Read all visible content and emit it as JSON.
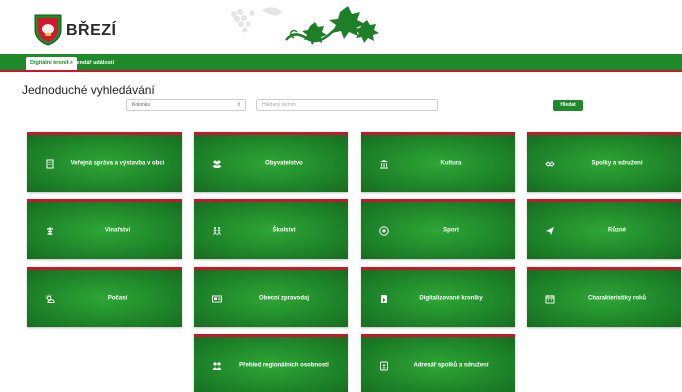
{
  "header": {
    "brand": "BŘEZÍ"
  },
  "nav": {
    "tabs": [
      "Digitální kronika",
      "Kalendář událostí"
    ]
  },
  "search": {
    "title": "Jednoduché vyhledávání",
    "select_value": "Kolonka",
    "input_placeholder": "Hledaný termín",
    "button_label": "Hledat"
  },
  "tiles": [
    {
      "label": "Veřejná správa a výstavba v obci",
      "icon": "building-icon"
    },
    {
      "label": "Obyvatelstvo",
      "icon": "people-icon"
    },
    {
      "label": "Kultura",
      "icon": "museum-icon"
    },
    {
      "label": "Spolky a sdružení",
      "icon": "handshake-icon"
    },
    {
      "label": "Vinařství",
      "icon": "grapevine-icon"
    },
    {
      "label": "Školství",
      "icon": "children-icon"
    },
    {
      "label": "Sport",
      "icon": "football-icon"
    },
    {
      "label": "Různé",
      "icon": "paper-plane-icon"
    },
    {
      "label": "Počasí",
      "icon": "weather-icon"
    },
    {
      "label": "Obecní zpravodaj",
      "icon": "newspaper-icon"
    },
    {
      "label": "Digitalizované kroniky",
      "icon": "book-icon"
    },
    {
      "label": "Charakteristiky roků",
      "icon": "calendar-icon"
    },
    {
      "label": "Přehled regionálních osobností",
      "icon": "persons-icon"
    },
    {
      "label": "Adresář spolků a sdružení",
      "icon": "address-book-icon"
    }
  ]
}
